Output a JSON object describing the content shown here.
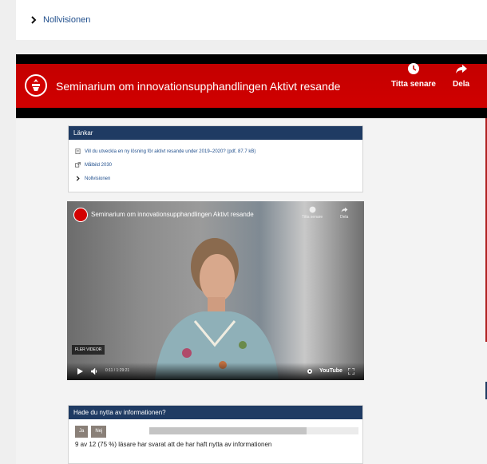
{
  "top_link": {
    "label": "Nollvisionen"
  },
  "banner": {
    "title": "Seminarium om innovationsupphandlingen Aktivt resande",
    "watch_later": "Titta senare",
    "share": "Dela",
    "color": "#c40000"
  },
  "links_box": {
    "header": "Länkar",
    "items": [
      {
        "label": "Vill du utveckla en ny lösning för aktivt resande under 2019–2020? (pdf, 87.7 kB)",
        "icon": "document-icon"
      },
      {
        "label": "Målbild 2030",
        "icon": "external-link-icon"
      },
      {
        "label": "Nollvisionen",
        "icon": "chevron-right-icon"
      }
    ]
  },
  "video": {
    "title": "Seminarium om innovationsupphandlingen Aktivt resande",
    "watch_later": "Titta senare",
    "share": "Dela",
    "more_videos": "FLER VIDEOR",
    "time": "0:11 / 1:29:21",
    "youtube": "YouTube",
    "progress_fraction": 0.002
  },
  "feedback": {
    "header": "Hade du nytta av informationen?",
    "yes": "Ja",
    "no": "Nej",
    "stat": "9 av 12 (75 %) läsare har svarat att de har haft nytta av informationen",
    "fraction": 0.75
  },
  "colors": {
    "navy": "#1f3b63",
    "link": "#1f4e8c",
    "button": "#8a8078"
  }
}
